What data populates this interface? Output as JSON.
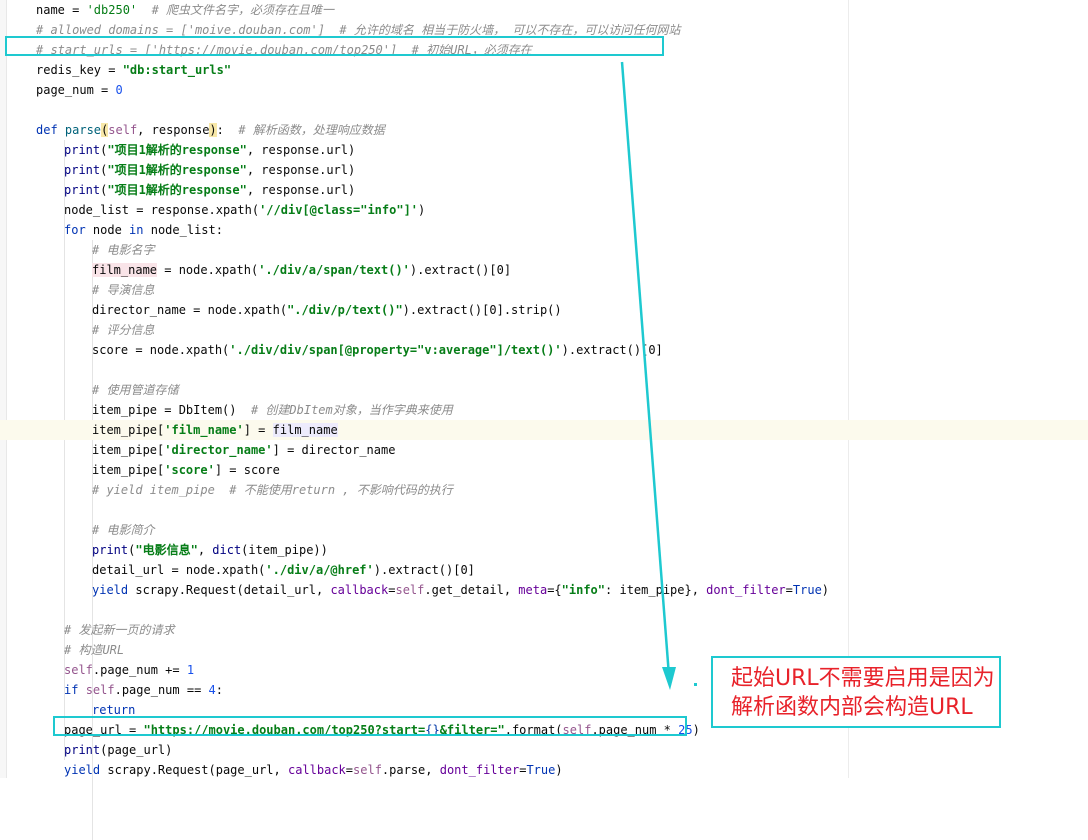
{
  "editor": {
    "lines": [
      [
        [
          "",
          "name = "
        ],
        [
          "st",
          "'db250'"
        ],
        [
          "",
          "  "
        ],
        [
          "cm",
          "# 爬虫文件名字，必须存在且唯一"
        ]
      ],
      [
        [
          "cm",
          "# allowed_domains = ['moive.douban.com']  # 允许的域名 相当于防火墙， 可以不存在，可以访问任何网站"
        ]
      ],
      [
        [
          "cm",
          "# start_urls = ['https://movie.douban.com/top250']  # 初始URL，必须存在"
        ]
      ],
      [
        [
          "",
          "redis_key = "
        ],
        [
          "sb",
          "\"db:start_urls\""
        ]
      ],
      [
        [
          "",
          "page_num = "
        ],
        [
          "nm",
          "0"
        ]
      ],
      [],
      [
        [
          "kw",
          "def "
        ],
        [
          "fn",
          "parse"
        ],
        [
          "paren-match",
          "("
        ],
        [
          "sf",
          "self"
        ],
        [
          "",
          ", response"
        ],
        [
          "paren-match",
          ")"
        ],
        [
          "",
          ":  "
        ],
        [
          "cm",
          "# 解析函数，处理响应数据"
        ]
      ],
      [
        [
          "bi",
          "print"
        ],
        [
          "",
          "("
        ],
        [
          "sb",
          "\"项目1解析的response\""
        ],
        [
          "",
          ", response.url)"
        ]
      ],
      [
        [
          "bi",
          "print"
        ],
        [
          "",
          "("
        ],
        [
          "sb",
          "\"项目1解析的response\""
        ],
        [
          "",
          ", response.url)"
        ]
      ],
      [
        [
          "bi",
          "print"
        ],
        [
          "",
          "("
        ],
        [
          "sb",
          "\"项目1解析的response\""
        ],
        [
          "",
          ", response.url)"
        ]
      ],
      [
        [
          "",
          "node_list = response.xpath("
        ],
        [
          "sb",
          "'//div[@class=\"info\"]'"
        ],
        [
          "",
          ")"
        ]
      ],
      [
        [
          "kw",
          "for "
        ],
        [
          "",
          "node "
        ],
        [
          "kw",
          "in "
        ],
        [
          "",
          "node_list:"
        ]
      ],
      [
        [
          "cm",
          "# 电影名字"
        ]
      ],
      [
        [
          "var-hl",
          "film_name"
        ],
        [
          "",
          " = node.xpath("
        ],
        [
          "sb",
          "'./div/a/span/text()'"
        ],
        [
          "",
          ").extract()[0]"
        ]
      ],
      [
        [
          "cm",
          "# 导演信息"
        ]
      ],
      [
        [
          "",
          "director_name = node.xpath("
        ],
        [
          "sb",
          "\"./div/p/text()\""
        ],
        [
          "",
          ").extract()[0].strip()"
        ]
      ],
      [
        [
          "cm",
          "# 评分信息"
        ]
      ],
      [
        [
          "",
          "score = node.xpath("
        ],
        [
          "sb",
          "'./div/div/span[@property=\"v:average\"]/text()'"
        ],
        [
          "",
          ").extract()[0]"
        ]
      ],
      [],
      [
        [
          "cm",
          "# 使用管道存储"
        ]
      ],
      [
        [
          "",
          "item_pipe = DbItem()  "
        ],
        [
          "cm",
          "# 创建DbItem对象，当作字典来使用"
        ]
      ],
      [
        [
          "",
          "item_pipe["
        ],
        [
          "sb",
          "'film_name'"
        ],
        [
          "",
          "] = "
        ],
        [
          "var-hl2",
          "film_name"
        ]
      ],
      [
        [
          "",
          "item_pipe["
        ],
        [
          "sb",
          "'director_name'"
        ],
        [
          "",
          "] = director_name"
        ]
      ],
      [
        [
          "",
          "item_pipe["
        ],
        [
          "sb",
          "'score'"
        ],
        [
          "",
          "] = score"
        ]
      ],
      [
        [
          "cm",
          "# yield item_pipe  # 不能使用return , 不影响代码的执行"
        ]
      ],
      [],
      [
        [
          "cm",
          "# 电影简介"
        ]
      ],
      [
        [
          "bi",
          "print"
        ],
        [
          "",
          "("
        ],
        [
          "sb",
          "\"电影信息\""
        ],
        [
          "",
          ", "
        ],
        [
          "bi",
          "dict"
        ],
        [
          "",
          "(item_pipe))"
        ]
      ],
      [
        [
          "",
          "detail_url = node.xpath("
        ],
        [
          "sb",
          "'./div/a/@href'"
        ],
        [
          "",
          ").extract()[0]"
        ]
      ],
      [
        [
          "kw",
          "yield "
        ],
        [
          "",
          "scrapy.Request(detail_url, "
        ],
        [
          "kwarg",
          "callback"
        ],
        [
          "",
          "="
        ],
        [
          "sf",
          "self"
        ],
        [
          "",
          ".get_detail, "
        ],
        [
          "kwarg",
          "meta"
        ],
        [
          "",
          "={"
        ],
        [
          "sb",
          "\"info\""
        ],
        [
          "",
          ": item_pipe}, "
        ],
        [
          "kwarg",
          "dont_filter"
        ],
        [
          "",
          "="
        ],
        [
          "kw",
          "True"
        ],
        [
          "",
          ")"
        ]
      ],
      [],
      [
        [
          "cm",
          "# 发起新一页的请求"
        ]
      ],
      [
        [
          "cm",
          "# 构造URL"
        ]
      ],
      [
        [
          "sf",
          "self"
        ],
        [
          "",
          ".page_num += "
        ],
        [
          "nm",
          "1"
        ]
      ],
      [
        [
          "kw",
          "if "
        ],
        [
          "sf",
          "self"
        ],
        [
          "",
          ".page_num == "
        ],
        [
          "nm",
          "4"
        ],
        [
          "",
          ":"
        ]
      ],
      [
        [
          "kw",
          "return"
        ]
      ],
      [
        [
          "",
          "page_url = "
        ],
        [
          "sb",
          "\"https://movie.douban.com/top250?start="
        ],
        [
          "ec",
          "{}"
        ],
        [
          "sb",
          "&filter=\""
        ],
        [
          "",
          ".format("
        ],
        [
          "sf",
          "self"
        ],
        [
          "",
          ".page_num * "
        ],
        [
          "nm",
          "25"
        ],
        [
          "",
          ")"
        ]
      ],
      [
        [
          "bi",
          "print"
        ],
        [
          "",
          "(page_url)"
        ]
      ],
      [
        [
          "kw",
          "yield "
        ],
        [
          "",
          "scrapy.Request(page_url, "
        ],
        [
          "kwarg",
          "callback"
        ],
        [
          "",
          "="
        ],
        [
          "sf",
          "self"
        ],
        [
          "",
          ".parse, "
        ],
        [
          "kwarg",
          "dont_filter"
        ],
        [
          "",
          "="
        ],
        [
          "kw",
          "True"
        ],
        [
          "",
          ")"
        ]
      ]
    ]
  },
  "annotation": {
    "callout_text": "起始URL不需要启用是因为解析函数内部会构造URL",
    "accent_color": "#1ec9d0",
    "text_color": "#e8222a"
  }
}
